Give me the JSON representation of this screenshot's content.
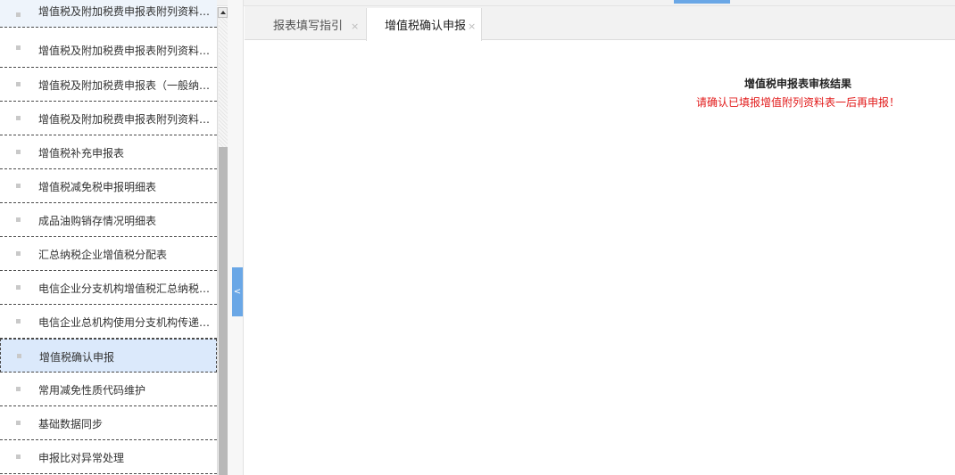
{
  "sidebar": {
    "items": [
      {
        "label": "增值税及附加税费申报表附列资料（一）"
      },
      {
        "label": "增值税及附加税费申报表附列资料（四）"
      },
      {
        "label": "增值税及附加税费申报表（一般纳税人..."
      },
      {
        "label": "增值税及附加税费申报表附列资料（五）"
      },
      {
        "label": "增值税补充申报表"
      },
      {
        "label": "增值税减免税申报明细表"
      },
      {
        "label": "成品油购销存情况明细表"
      },
      {
        "label": "汇总纳税企业增值税分配表"
      },
      {
        "label": "电信企业分支机构增值税汇总纳税信息..."
      },
      {
        "label": "电信企业总机构使用分支机构传递单情..."
      },
      {
        "label": "增值税确认申报"
      },
      {
        "label": "常用减免性质代码维护"
      },
      {
        "label": "基础数据同步"
      },
      {
        "label": "申报比对异常处理"
      }
    ],
    "active_index": 10,
    "collapse_button": "<"
  },
  "tabs": [
    {
      "label": "报表填写指引",
      "close": "×",
      "active": false
    },
    {
      "label": "增值税确认申报",
      "close": "×",
      "active": true
    }
  ],
  "content": {
    "title": "增值税申报表审核结果",
    "message": "请确认已填报增值附列资料表一后再申报！"
  },
  "colors": {
    "accent": "#6aa7e6",
    "active_item_bg": "#dbe9fb",
    "warning_text": "#e21b1b"
  }
}
